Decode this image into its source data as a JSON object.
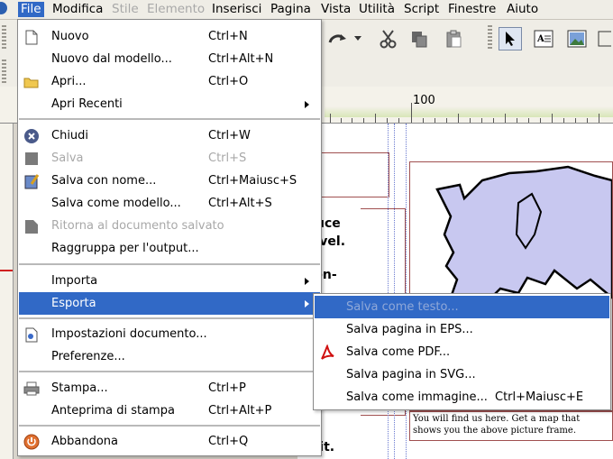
{
  "menubar": {
    "items": [
      {
        "label": "File",
        "state": "active"
      },
      {
        "label": "Modifica",
        "state": "normal"
      },
      {
        "label": "Stile",
        "state": "disabled"
      },
      {
        "label": "Elemento",
        "state": "disabled"
      },
      {
        "label": "Inserisci",
        "state": "normal"
      },
      {
        "label": "Pagina",
        "state": "normal"
      },
      {
        "label": "Vista",
        "state": "normal"
      },
      {
        "label": "Utilità",
        "state": "normal"
      },
      {
        "label": "Script",
        "state": "normal"
      },
      {
        "label": "Finestre",
        "state": "normal"
      },
      {
        "label": "Aiuto",
        "state": "normal"
      }
    ]
  },
  "ruler": {
    "mark": "100"
  },
  "file_menu": {
    "items": [
      {
        "label": "Nuovo",
        "shortcut": "Ctrl+N",
        "icon": "new-document-icon",
        "enabled": true
      },
      {
        "label": "Nuovo dal modello...",
        "shortcut": "Ctrl+Alt+N",
        "icon": "",
        "enabled": true
      },
      {
        "label": "Apri...",
        "shortcut": "Ctrl+O",
        "icon": "folder-icon",
        "enabled": true
      },
      {
        "label": "Apri Recenti",
        "shortcut": "",
        "icon": "",
        "enabled": true,
        "submenu": true
      },
      {
        "label": "Chiudi",
        "shortcut": "Ctrl+W",
        "icon": "close-icon",
        "enabled": true
      },
      {
        "label": "Salva",
        "shortcut": "Ctrl+S",
        "icon": "save-icon",
        "enabled": false
      },
      {
        "label": "Salva con nome...",
        "shortcut": "Ctrl+Maiusc+S",
        "icon": "save-as-icon",
        "enabled": true
      },
      {
        "label": "Salva come modello...",
        "shortcut": "Ctrl+Alt+S",
        "icon": "",
        "enabled": true
      },
      {
        "label": "Ritorna al documento salvato",
        "shortcut": "",
        "icon": "revert-icon",
        "enabled": false
      },
      {
        "label": "Raggruppa per l'output...",
        "shortcut": "",
        "icon": "",
        "enabled": true
      },
      {
        "label": "Importa",
        "shortcut": "",
        "icon": "",
        "enabled": true,
        "submenu": true
      },
      {
        "label": "Esporta",
        "shortcut": "",
        "icon": "",
        "enabled": true,
        "submenu": true,
        "highlighted": true
      },
      {
        "label": "Impostazioni documento...",
        "shortcut": "",
        "icon": "document-settings-icon",
        "enabled": true
      },
      {
        "label": "Preferenze...",
        "shortcut": "",
        "icon": "",
        "enabled": true
      },
      {
        "label": "Stampa...",
        "shortcut": "Ctrl+P",
        "icon": "printer-icon",
        "enabled": true
      },
      {
        "label": "Anteprima di stampa",
        "shortcut": "Ctrl+Alt+P",
        "icon": "",
        "enabled": true
      },
      {
        "label": "Abbandona",
        "shortcut": "Ctrl+Q",
        "icon": "quit-icon",
        "enabled": true
      }
    ]
  },
  "export_submenu": {
    "items": [
      {
        "label": "Salva come testo...",
        "shortcut": "",
        "icon": "",
        "highlighted": true
      },
      {
        "label": "Salva pagina in EPS...",
        "shortcut": "",
        "icon": ""
      },
      {
        "label": "Salva come PDF...",
        "shortcut": "",
        "icon": "pdf-icon"
      },
      {
        "label": "Salva pagina in SVG...",
        "shortcut": "",
        "icon": ""
      },
      {
        "label": "Salva come immagine...",
        "shortcut": "Ctrl+Maiusc+E",
        "icon": ""
      }
    ]
  },
  "document": {
    "text_lines": [
      "duce",
      "level.",
      "con-",
      "elit."
    ],
    "caption": "You will find us here. Get a map that shows you the above picture frame."
  },
  "colors": {
    "highlight": "#3169c6",
    "frame": "#a05050",
    "map_fill": "#c8c8f0"
  }
}
